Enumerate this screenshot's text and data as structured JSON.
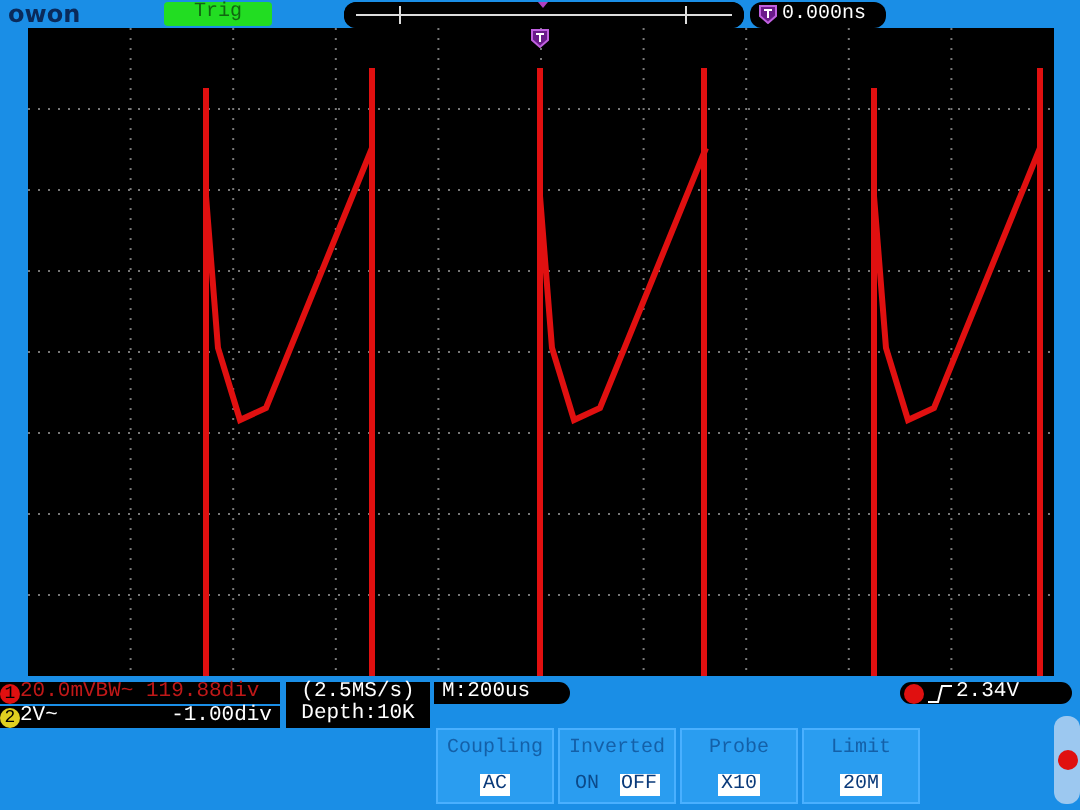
{
  "top_bar": {
    "logo": "owon",
    "trigger_status": "Trig",
    "trigger_position": "0.000ns"
  },
  "channels": [
    {
      "marker": "1",
      "color": "#e01010",
      "scale": "20.0mVBW~ 119.88div"
    },
    {
      "marker": "2",
      "color": "#e0d020",
      "scale": "2V~",
      "offset": "-1.00div"
    }
  ],
  "acquisition": {
    "sample_rate": "(2.5MS/s)",
    "depth": "Depth:10K"
  },
  "timebase": "M:200us",
  "trigger_level": "2.34V",
  "menu": [
    {
      "kind": "value",
      "title": "Coupling",
      "value": "AC"
    },
    {
      "kind": "toggle",
      "title": "Inverted",
      "options": [
        {
          "label": "ON",
          "selected": false
        },
        {
          "label": "OFF",
          "selected": true
        }
      ]
    },
    {
      "kind": "value",
      "title": "Probe",
      "value": "X10"
    },
    {
      "kind": "value",
      "title": "Limit",
      "value": "20M"
    }
  ]
}
